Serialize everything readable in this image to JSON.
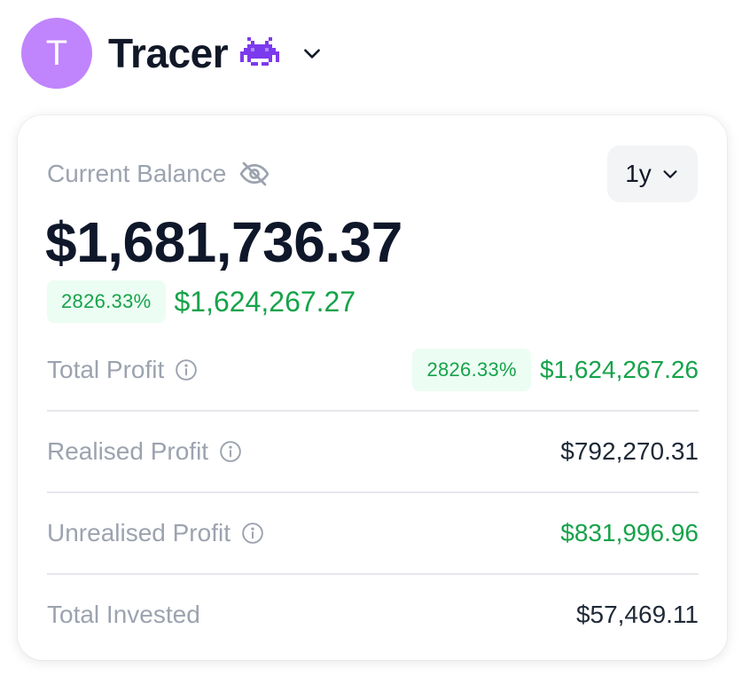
{
  "header": {
    "avatar_letter": "T",
    "account_name": "Tracer",
    "avatar_color": "#c084fc",
    "emoji_icon": "alien-monster-icon",
    "dropdown_icon": "chevron-down-icon"
  },
  "balance": {
    "label": "Current Balance",
    "visibility_icon": "eye-off-icon",
    "value": "$1,681,736.37",
    "change_percent": "2826.33%",
    "change_amount": "$1,624,267.27",
    "range": "1y"
  },
  "rows": [
    {
      "label": "Total Profit",
      "info_icon": "info-icon",
      "percent": "2826.33%",
      "value": "$1,624,267.26",
      "status": "positive"
    },
    {
      "label": "Realised Profit",
      "info_icon": "info-icon",
      "value": "$792,270.31",
      "status": "neutral"
    },
    {
      "label": "Unrealised Profit",
      "info_icon": "info-icon",
      "value": "$831,996.96",
      "status": "positive"
    },
    {
      "label": "Total Invested",
      "value": "$57,469.11",
      "status": "neutral"
    }
  ],
  "colors": {
    "positive": "#16a34a",
    "positive_bg": "#ecfdf3",
    "muted_text": "#9ca3af",
    "primary_text": "#0f172a"
  }
}
